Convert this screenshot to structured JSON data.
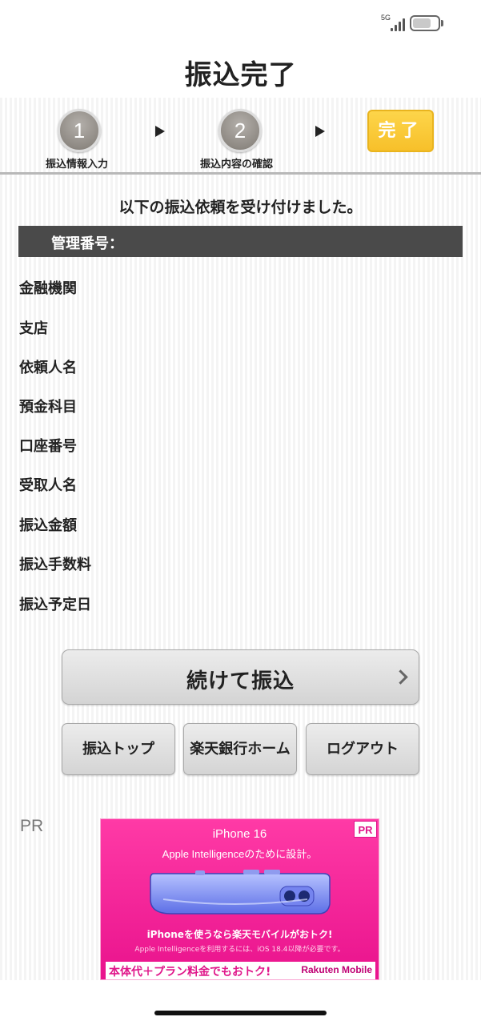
{
  "status_bar": {
    "network": "5G",
    "signal_bars": 4,
    "battery_level": 0.72
  },
  "header": {
    "title": "振込完了"
  },
  "steps": [
    {
      "number": "1",
      "label": "振込情報入力"
    },
    {
      "number": "2",
      "label": "振込内容の確認"
    },
    {
      "label": "完了"
    }
  ],
  "notice": "以下の振込依頼を受け付けました。",
  "management_label": "管理番号：",
  "rows": [
    {
      "label": "金融機関"
    },
    {
      "label": "支店"
    },
    {
      "label": "依頼人名"
    },
    {
      "label": "預金科目"
    },
    {
      "label": "口座番号"
    },
    {
      "label": "受取人名"
    },
    {
      "label": "振込金額"
    },
    {
      "label": "振込手数料"
    },
    {
      "label": "振込予定日"
    }
  ],
  "buttons": {
    "continue": "続けて振込",
    "transfer_top": "振込トップ",
    "bank_home": "楽天銀行ホーム",
    "logout": "ログアウト"
  },
  "pr_label": "PR",
  "ad": {
    "badge": "PR",
    "logo": " iPhone 16",
    "tagline": "Apple Intelligenceのために設計。",
    "line1": "iPhoneを使うなら楽天モバイルがおトク!",
    "line2": "Apple Intelligenceを利用するには、iOS 18.4以降が必要です。",
    "cta": "本体代＋プラン料金でもおトク!",
    "brand": "Rakuten Mobile"
  }
}
